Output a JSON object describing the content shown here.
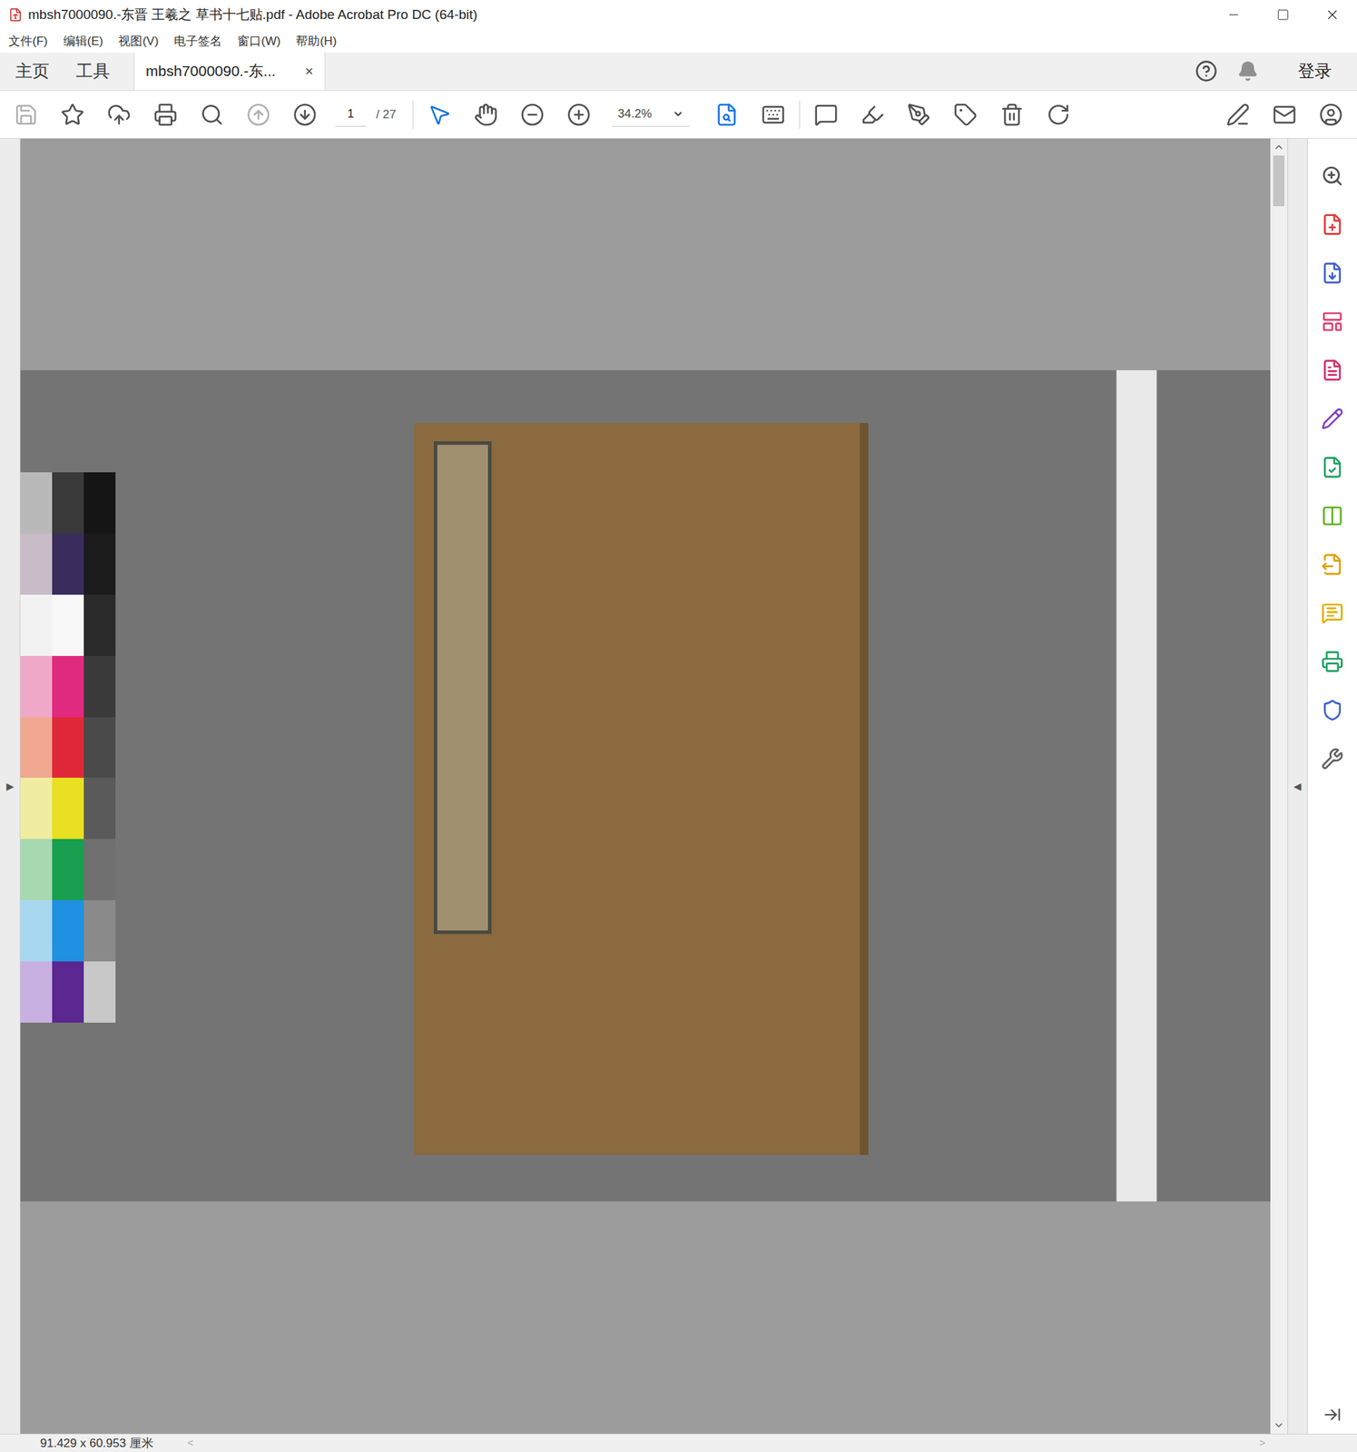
{
  "window": {
    "title": "mbsh7000090.-东晋 王羲之 草书十七贴.pdf - Adobe Acrobat Pro DC (64-bit)"
  },
  "menu": [
    "文件(F)",
    "编辑(E)",
    "视图(V)",
    "电子签名",
    "窗口(W)",
    "帮助(H)"
  ],
  "nav_tabs": [
    {
      "label": "主页",
      "selected": false
    },
    {
      "label": "工具",
      "selected": false
    }
  ],
  "doc_tab": {
    "label": "mbsh7000090.-东...",
    "close": "×",
    "selected": true
  },
  "account": {
    "label": "登录"
  },
  "toolbar": {
    "page": "1",
    "page_count": "/ 27",
    "zoom": "34.2%"
  },
  "side_toggles": {
    "left": "▶",
    "right": "◀"
  },
  "scrollbar": {
    "level": 0.04
  },
  "status_bar": {
    "dimensions": "91.429 x 60.953 厘米",
    "scroll_left": "<",
    "scroll_right": ">"
  }
}
